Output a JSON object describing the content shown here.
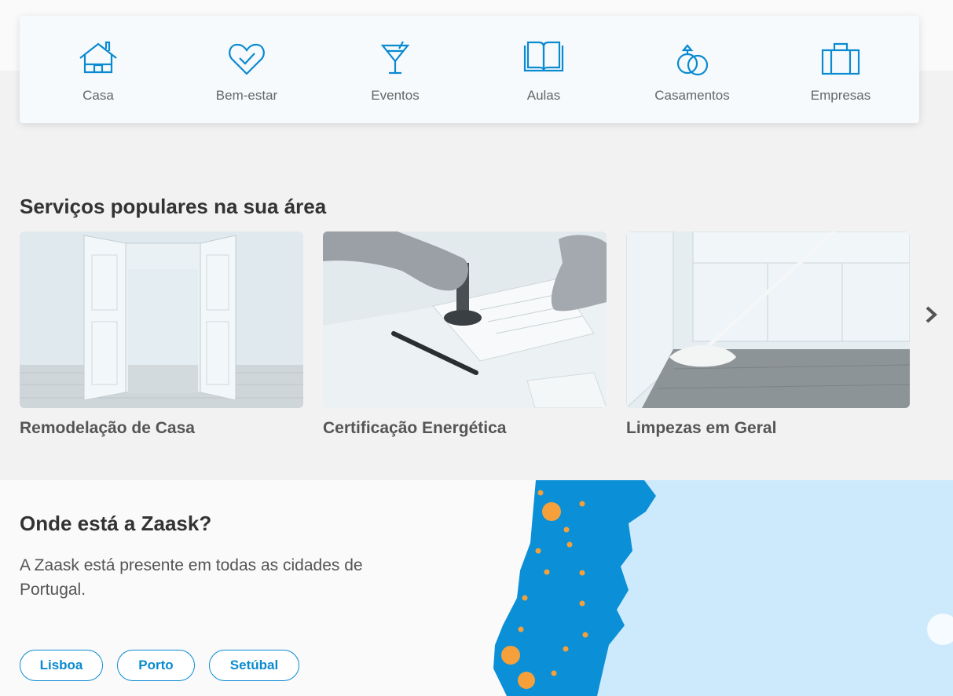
{
  "categories": [
    {
      "label": "Casa",
      "icon": "house-icon"
    },
    {
      "label": "Bem-estar",
      "icon": "heart-check-icon"
    },
    {
      "label": "Eventos",
      "icon": "cocktail-glass-icon"
    },
    {
      "label": "Aulas",
      "icon": "open-book-icon"
    },
    {
      "label": "Casamentos",
      "icon": "wedding-rings-icon"
    },
    {
      "label": "Empresas",
      "icon": "briefcase-icon"
    }
  ],
  "popular": {
    "title": "Serviços populares na sua área",
    "services": [
      {
        "name": "Remodelação de Casa",
        "image": "empty-room-open-doors-image"
      },
      {
        "name": "Certificação Energética",
        "image": "hand-stamping-document-image"
      },
      {
        "name": "Limpezas em Geral",
        "image": "mop-cleaning-floor-image"
      }
    ],
    "next_icon": "chevron-right-icon"
  },
  "where": {
    "title": "Onde está a Zaask?",
    "description": "A Zaask está presente em todas as cidades de Portugal.",
    "cities": [
      "Lisboa",
      "Porto",
      "Setúbal"
    ],
    "map_icon": "portugal-map-image"
  },
  "colors": {
    "accent": "#0a8ad1",
    "map_land": "#0b8fd6",
    "map_sea": "#cdeafc",
    "marker": "#f5a03a"
  }
}
